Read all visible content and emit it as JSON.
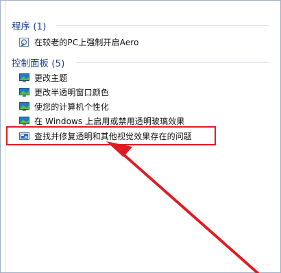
{
  "sections": [
    {
      "header": "程序 (1)",
      "items": [
        {
          "label": "在较老的PC上强制开启Aero",
          "icon": "program-shortcut-icon"
        }
      ]
    },
    {
      "header": "控制面板 (5)",
      "items": [
        {
          "label": "更改主题",
          "icon": "personalization-icon"
        },
        {
          "label": "更改半透明窗口颜色",
          "icon": "personalization-icon"
        },
        {
          "label": "使您的计算机个性化",
          "icon": "personalization-icon"
        },
        {
          "label": "在 Windows 上启用或禁用透明玻璃效果",
          "icon": "personalization-icon"
        },
        {
          "label": "查找并修复透明和其他视觉效果存在的问题",
          "icon": "troubleshoot-icon"
        }
      ]
    }
  ],
  "colors": {
    "header_text": "#1e3f8a",
    "annotation_red": "#e01b23"
  }
}
